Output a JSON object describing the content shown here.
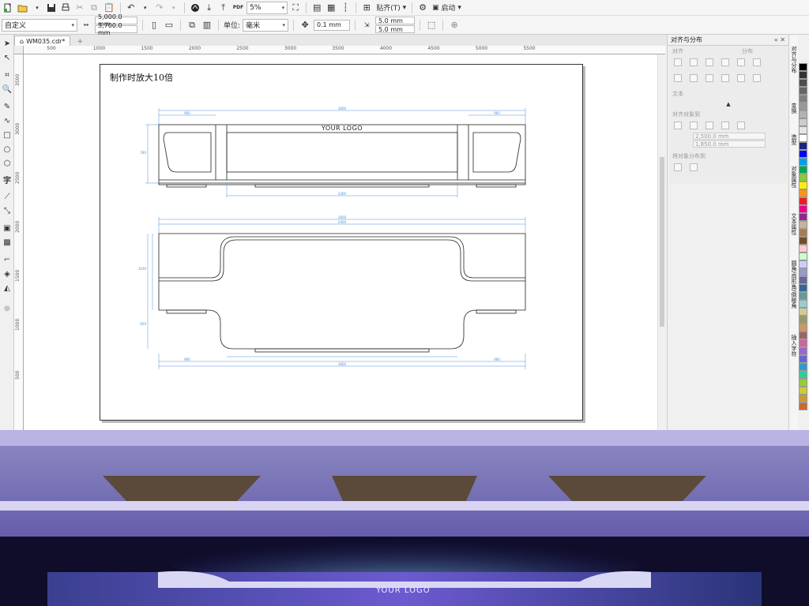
{
  "toolbar1": {
    "zoom": "5%",
    "paste_label": "贴齐(T)",
    "launch_label": "启动"
  },
  "toolbar2": {
    "page_preset": "自定义",
    "page_width": "5,000.0 mm",
    "page_height": "3,700.0 mm",
    "unit_label": "单位:",
    "unit_value": "毫米",
    "nudge": "0.1 mm",
    "dup_x": "5.0 mm",
    "dup_y": "5.0 mm"
  },
  "document": {
    "tab_name": "WM035.cdr*"
  },
  "ruler": {
    "h_ticks": [
      "500",
      "1000",
      "1500",
      "2000",
      "2500",
      "3000",
      "3500",
      "4000",
      "4500",
      "5000",
      "5500"
    ],
    "v_ticks": [
      "3500",
      "3000",
      "2500",
      "2000",
      "1500",
      "1000",
      "500"
    ]
  },
  "canvas": {
    "note": "制作时放大10倍",
    "logo_text": "YOUR LOGO",
    "dimensions": {
      "top_total": "3600",
      "top_inner": "2400",
      "top_left": "960",
      "top_right": "960",
      "bottom_total": "3600",
      "bottom_inner": "2400",
      "bottom_left": "960",
      "bottom_right": "960",
      "side_top": "780",
      "side_mid": "1030",
      "side_bottom": "620"
    }
  },
  "docker": {
    "title": "对齐与分布",
    "section_align": "对齐",
    "section_distribute": "分布",
    "section_text": "文本",
    "section_objects": "对齐对象到",
    "pos_x": "2,500.0 mm",
    "pos_y": "1,850.0 mm",
    "section_dist_to": "将对象分布到"
  },
  "docker_tabs": [
    "对齐与分布",
    "变换",
    "造型",
    "对象属性",
    "文本属性",
    "圆角/扇形角/倒棱角",
    "插入字符"
  ],
  "palette": [
    "#000000",
    "#333333",
    "#4d4d4d",
    "#666666",
    "#808080",
    "#999999",
    "#b3b3b3",
    "#cccccc",
    "#e6e6e6",
    "#ffffff",
    "#1a237e",
    "#0000ff",
    "#00a0e9",
    "#00a651",
    "#8dc63f",
    "#fff200",
    "#f7941d",
    "#ed1c24",
    "#ec008c",
    "#92278f",
    "#c7b299",
    "#a67c52",
    "#754c24",
    "#ffcccc",
    "#ccffcc",
    "#ccccff",
    "#9999cc",
    "#666699",
    "#336699",
    "#669999",
    "#99cccc",
    "#cccc99",
    "#999966",
    "#cc9966",
    "#996666",
    "#cc6699",
    "#9966cc",
    "#6666cc",
    "#3399cc",
    "#33cc99",
    "#99cc33",
    "#cccc33",
    "#cc9933",
    "#cc6633"
  ],
  "scene": {
    "logo_text": "YOUR LOGO"
  },
  "colors": {
    "dimension_line": "#4a90d9",
    "scene_bg": "#1b1a3d",
    "ceiling": "#c9c6e6"
  }
}
